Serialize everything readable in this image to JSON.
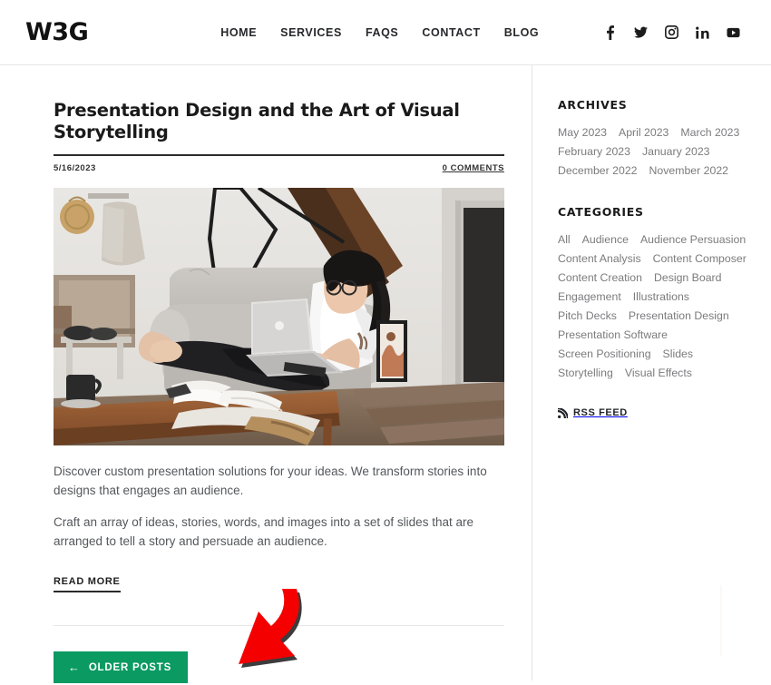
{
  "header": {
    "logo": "W3G",
    "nav": [
      {
        "label": "HOME"
      },
      {
        "label": "SERVICES"
      },
      {
        "label": "FAQS"
      },
      {
        "label": "CONTACT"
      },
      {
        "label": "BLOG"
      }
    ],
    "social": [
      {
        "name": "facebook-icon"
      },
      {
        "name": "twitter-icon"
      },
      {
        "name": "instagram-icon"
      },
      {
        "name": "linkedin-icon"
      },
      {
        "name": "youtube-icon"
      }
    ]
  },
  "post": {
    "title": "Presentation Design and the Art of Visual Storytelling",
    "date": "5/16/2023",
    "comments": "0 COMMENTS",
    "image_alt": "Woman sitting on a light grey sofa using a laptop in a living room",
    "paragraphs": [
      "Discover custom presentation solutions for your ideas. We transform stories into designs that engages an audience.",
      "Craft an array of ideas, stories, words, and images into a set of slides that are arranged to tell a story and persuade an audience."
    ],
    "read_more": "READ MORE"
  },
  "pagination": {
    "older_posts": "OLDER POSTS",
    "arrow_glyph": "←"
  },
  "sidebar": {
    "archives": {
      "title": "ARCHIVES",
      "items": [
        "May 2023",
        "April 2023",
        "March 2023",
        "February 2023",
        "January 2023",
        "December 2022",
        "November 2022"
      ]
    },
    "categories": {
      "title": "CATEGORIES",
      "items": [
        "All",
        "Audience",
        "Audience Persuasion",
        "Content Analysis",
        "Content Composer",
        "Content Creation",
        "Design Board",
        "Engagement",
        "Illustrations",
        "Pitch Decks",
        "Presentation Design",
        "Presentation Software",
        "Screen Positioning",
        "Slides",
        "Storytelling",
        "Visual Effects"
      ]
    },
    "rss": {
      "label": "RSS FEED",
      "icon": "rss-icon"
    }
  },
  "annotation": {
    "type": "curved-arrow",
    "color": "#f50000",
    "outline": "#3a3a3a",
    "points_to": "OLDER POSTS"
  },
  "colors": {
    "accent_green": "#0a9a62",
    "text_dark": "#1a1a1a",
    "text_body": "#54585c",
    "link_grey": "#7b7b7e",
    "divider": "#e6e6e6",
    "annotation_red": "#f50000"
  }
}
